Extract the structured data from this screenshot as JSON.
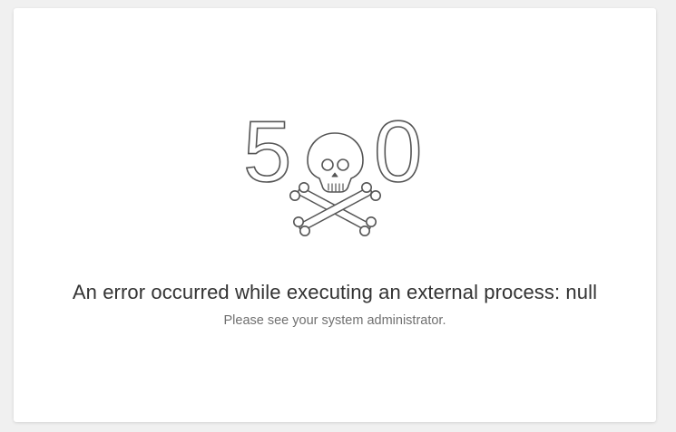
{
  "error": {
    "code_left_digit": "5",
    "code_right_digit": "0",
    "icon": "skull-and-crossbones-icon",
    "message": "An error occurred while executing an external process: null",
    "hint": "Please see your system administrator."
  },
  "colors": {
    "page_background": "#f0f0f0",
    "card_background": "#ffffff",
    "icon_stroke": "#555555",
    "heading_text": "#333333",
    "sub_text": "#707070"
  }
}
